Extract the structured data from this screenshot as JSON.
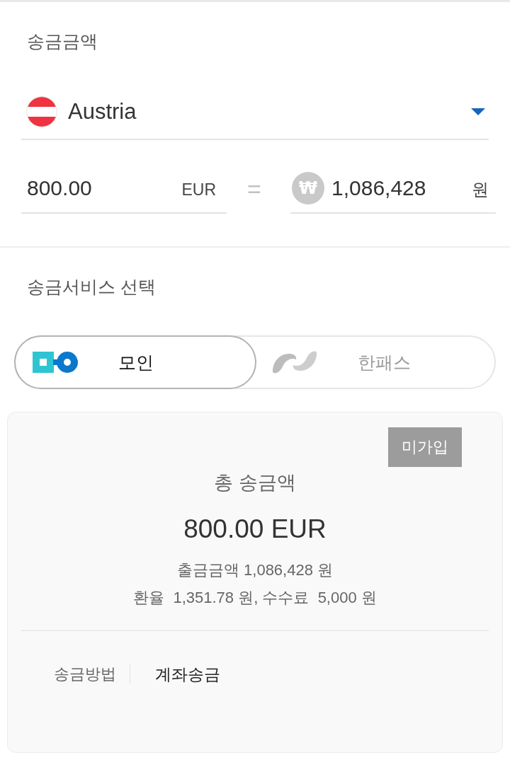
{
  "section_amount": {
    "title": "송금금액",
    "country": {
      "name": "Austria"
    },
    "send": {
      "value": "800.00",
      "currency": "EUR"
    },
    "equals": "=",
    "receive": {
      "currency_symbol": "₩",
      "value": "1,086,428",
      "unit": "원"
    }
  },
  "section_service": {
    "title": "송금서비스 선택",
    "services": [
      {
        "kind": "moin",
        "name": "모인",
        "selected": true
      },
      {
        "kind": "hanpass",
        "name": "한패스",
        "selected": false
      }
    ]
  },
  "result_card": {
    "badge": "미가입",
    "total_label": "총 송금액",
    "total_amount": "800.00 EUR",
    "withdraw_line": "출금금액 1,086,428 원",
    "rate_line": "환율  1,351.78 원, 수수료  5,000 원",
    "method_label": "송금방법",
    "method_value": "계좌송금"
  }
}
